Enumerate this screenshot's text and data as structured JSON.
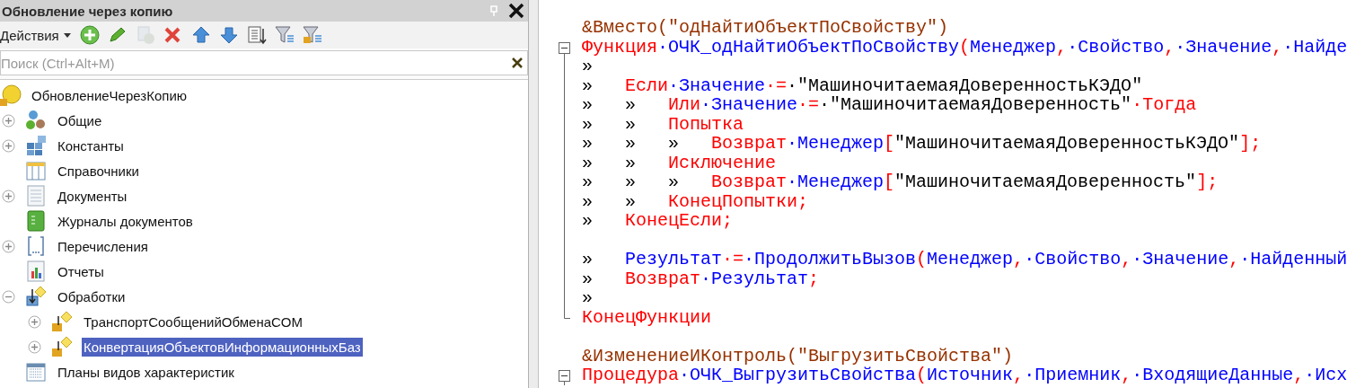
{
  "panel": {
    "title": "Обновление через копию",
    "pinned": false
  },
  "toolbar": {
    "menu": "Действия",
    "buttons": [
      {
        "kind": "add",
        "disabled": false
      },
      {
        "kind": "edit",
        "disabled": false
      },
      {
        "kind": "copy",
        "disabled": true
      },
      {
        "kind": "delete",
        "disabled": false
      },
      {
        "kind": "up",
        "disabled": false
      },
      {
        "kind": "down",
        "disabled": false
      },
      {
        "kind": "list",
        "disabled": false
      },
      {
        "kind": "filter",
        "disabled": false
      },
      {
        "kind": "filter-sub",
        "disabled": false
      }
    ]
  },
  "search": {
    "placeholder": "Поиск (Ctrl+Alt+M)"
  },
  "tree": [
    {
      "label": "ОбновлениеЧерезКопию",
      "kind": "config",
      "selected": false,
      "children": [
        {
          "label": "Общие",
          "kind": "common",
          "expanded": false,
          "selected": false
        },
        {
          "label": "Константы",
          "kind": "constants",
          "expanded": false,
          "selected": false
        },
        {
          "label": "Справочники",
          "kind": "catalogs",
          "selected": false
        },
        {
          "label": "Документы",
          "kind": "documents",
          "expanded": false,
          "selected": false
        },
        {
          "label": "Журналы документов",
          "kind": "journals",
          "selected": false
        },
        {
          "label": "Перечисления",
          "kind": "enums",
          "expanded": false,
          "selected": false
        },
        {
          "label": "Отчеты",
          "kind": "reports",
          "selected": false
        },
        {
          "label": "Обработки",
          "kind": "processors",
          "expanded": true,
          "selected": false,
          "children": [
            {
              "label": "ТранспортСообщенийОбменаCOM",
              "kind": "processor",
              "expanded": false,
              "selected": false
            },
            {
              "label": "КонвертацияОбъектовИнформационныхБаз",
              "kind": "processor",
              "expanded": false,
              "selected": true
            }
          ]
        },
        {
          "label": "Планы видов характеристик",
          "kind": "charts",
          "selected": false
        }
      ]
    }
  ],
  "code": [
    {
      "kind": "line",
      "tokens": [
        {
          "kind": "directive",
          "text": "&Вместо(\"одНайтиОбъектПоСвойству\")"
        }
      ]
    },
    {
      "kind": "fold",
      "expanded": true,
      "lines": [
        {
          "tokens": [
            {
              "kind": "keyword",
              "text": "Функция"
            },
            {
              "kind": "ident",
              "text": "·ОЧК_одНайтиОбъектПоСвойству"
            },
            {
              "kind": "punct",
              "text": "("
            },
            {
              "kind": "ident",
              "text": "Менеджер"
            },
            {
              "kind": "punct",
              "text": ","
            },
            {
              "kind": "ident",
              "text": "·Свойство"
            },
            {
              "kind": "punct",
              "text": ","
            },
            {
              "kind": "ident",
              "text": "·Значение"
            },
            {
              "kind": "punct",
              "text": ","
            },
            {
              "kind": "ident",
              "text": "·Найде"
            }
          ]
        },
        {
          "tokens": [
            {
              "kind": "tab",
              "text": "»"
            }
          ]
        },
        {
          "tokens": [
            {
              "kind": "tab",
              "text": "»"
            },
            {
              "kind": "keyword",
              "text": "Если"
            },
            {
              "kind": "ident",
              "text": "·Значение"
            },
            {
              "kind": "punct",
              "text": "·="
            },
            {
              "kind": "string",
              "text": "·\"МашиночитаемаяДоверенностьКЭДО\""
            }
          ]
        },
        {
          "tokens": [
            {
              "kind": "tab",
              "text": "»"
            },
            {
              "kind": "tab",
              "text": "»"
            },
            {
              "kind": "keyword",
              "text": "Или"
            },
            {
              "kind": "ident",
              "text": "·Значение"
            },
            {
              "kind": "punct",
              "text": "·="
            },
            {
              "kind": "string",
              "text": "·\"МашиночитаемаяДоверенность\""
            },
            {
              "kind": "keyword",
              "text": "·Тогда"
            }
          ]
        },
        {
          "tokens": [
            {
              "kind": "tab",
              "text": "»"
            },
            {
              "kind": "tab",
              "text": "»"
            },
            {
              "kind": "keyword",
              "text": "Попытка"
            }
          ]
        },
        {
          "tokens": [
            {
              "kind": "tab",
              "text": "»"
            },
            {
              "kind": "tab",
              "text": "»"
            },
            {
              "kind": "tab",
              "text": "»"
            },
            {
              "kind": "keyword",
              "text": "Возврат"
            },
            {
              "kind": "ident",
              "text": "·Менеджер"
            },
            {
              "kind": "punct",
              "text": "["
            },
            {
              "kind": "string",
              "text": "\"МашиночитаемаяДоверенностьКЭДО\""
            },
            {
              "kind": "punct",
              "text": "];"
            }
          ]
        },
        {
          "tokens": [
            {
              "kind": "tab",
              "text": "»"
            },
            {
              "kind": "tab",
              "text": "»"
            },
            {
              "kind": "keyword",
              "text": "Исключение"
            }
          ]
        },
        {
          "tokens": [
            {
              "kind": "tab",
              "text": "»"
            },
            {
              "kind": "tab",
              "text": "»"
            },
            {
              "kind": "tab",
              "text": "»"
            },
            {
              "kind": "keyword",
              "text": "Возврат"
            },
            {
              "kind": "ident",
              "text": "·Менеджер"
            },
            {
              "kind": "punct",
              "text": "["
            },
            {
              "kind": "string",
              "text": "\"МашиночитаемаяДоверенность\""
            },
            {
              "kind": "punct",
              "text": "];"
            }
          ]
        },
        {
          "tokens": [
            {
              "kind": "tab",
              "text": "»"
            },
            {
              "kind": "tab",
              "text": "»"
            },
            {
              "kind": "keyword",
              "text": "КонецПопытки;"
            }
          ]
        },
        {
          "tokens": [
            {
              "kind": "tab",
              "text": "»"
            },
            {
              "kind": "keyword",
              "text": "КонецЕсли;"
            }
          ]
        },
        {
          "gap_before": true,
          "tokens": [
            {
              "kind": "tab",
              "text": "»"
            },
            {
              "kind": "ident",
              "text": "Результат"
            },
            {
              "kind": "punct",
              "text": "·="
            },
            {
              "kind": "ident",
              "text": "·ПродолжитьВызов"
            },
            {
              "kind": "punct",
              "text": "("
            },
            {
              "kind": "ident",
              "text": "Менеджер"
            },
            {
              "kind": "punct",
              "text": ","
            },
            {
              "kind": "ident",
              "text": "·Свойство"
            },
            {
              "kind": "punct",
              "text": ","
            },
            {
              "kind": "ident",
              "text": "·Значение"
            },
            {
              "kind": "punct",
              "text": ","
            },
            {
              "kind": "ident",
              "text": "·Найденный"
            }
          ]
        },
        {
          "tokens": [
            {
              "kind": "tab",
              "text": "»"
            },
            {
              "kind": "keyword",
              "text": "Возврат"
            },
            {
              "kind": "ident",
              "text": "·Результат"
            },
            {
              "kind": "punct",
              "text": ";"
            }
          ]
        },
        {
          "tokens": [
            {
              "kind": "tab",
              "text": "»"
            }
          ]
        },
        {
          "tokens": [
            {
              "kind": "keyword",
              "text": "КонецФункции"
            }
          ]
        }
      ]
    },
    {
      "kind": "line"
    },
    {
      "kind": "line",
      "tokens": [
        {
          "kind": "directive",
          "text": "&ИзменениеИКонтроль(\"ВыгрузитьСвойства\")"
        }
      ]
    },
    {
      "kind": "fold",
      "expanded": true,
      "lines": [
        {
          "tokens": [
            {
              "kind": "keyword",
              "text": "Процедура"
            },
            {
              "kind": "ident",
              "text": "·ОЧК_ВыгрузитьСвойства"
            },
            {
              "kind": "punct",
              "text": "("
            },
            {
              "kind": "ident",
              "text": "Источник"
            },
            {
              "kind": "punct",
              "text": ","
            },
            {
              "kind": "ident",
              "text": "·Приемник"
            },
            {
              "kind": "punct",
              "text": ","
            },
            {
              "kind": "ident",
              "text": "·ВходящиеДанные"
            },
            {
              "kind": "punct",
              "text": ","
            },
            {
              "kind": "ident",
              "text": "·Исх"
            }
          ]
        }
      ]
    }
  ]
}
